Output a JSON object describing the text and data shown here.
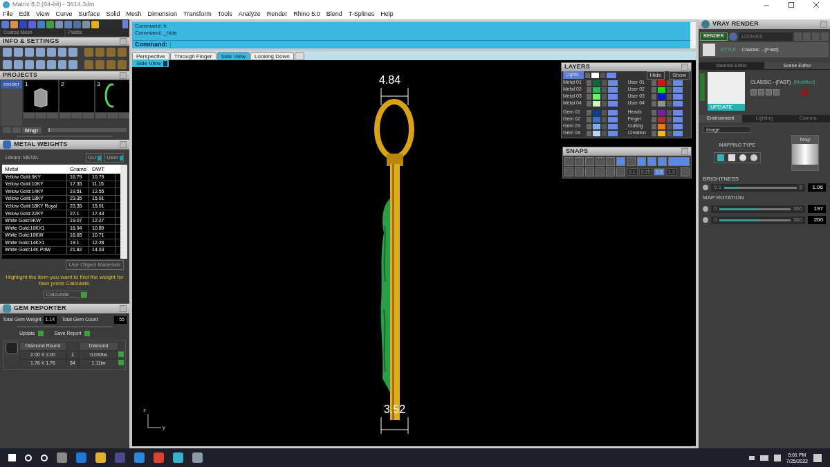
{
  "window": {
    "title": "Matrix 8.0 (64-bit) - 3614.3dm"
  },
  "menu": [
    "File",
    "Edit",
    "View",
    "Curve",
    "Surface",
    "Solid",
    "Mesh",
    "Dimension",
    "Transform",
    "Tools",
    "Analyze",
    "Render",
    "Rhino 5.0",
    "Blend",
    "T-Splines",
    "Help"
  ],
  "left_panel": {
    "mesh_dropdown": "Coarse Mesh",
    "material_dropdown": "Plastic",
    "info_title": "INFO & SETTINGS",
    "projects": {
      "title": "PROJECTS",
      "items": [
        {
          "label": "render",
          "selected": true
        }
      ],
      "slots": [
        "1",
        "2",
        "3"
      ],
      "manager_button": "Mngr",
      "thumbnail_slider": {
        "level": 0.02
      }
    },
    "metal_weights": {
      "title": "METAL WEIGHTS",
      "library": "Library: METAL",
      "toggles": [
        "GU",
        "User"
      ],
      "columns": [
        "Metal",
        "Grams",
        "DWT"
      ],
      "rows": [
        [
          "Yellow Gold:9KY",
          "16.79",
          "10.79"
        ],
        [
          "Yellow Gold:10KY",
          "17.35",
          "11.15"
        ],
        [
          "Yellow Gold:14KY",
          "19.51",
          "12.55"
        ],
        [
          "Yellow Gold:18KY",
          "23.35",
          "15.01"
        ],
        [
          "Yellow Gold:18KY Royal",
          "23.35",
          "15.01"
        ],
        [
          "Yellow Gold:22KY",
          "27.1",
          "17.43"
        ],
        [
          "White Gold:9KW",
          "19.07",
          "12.27"
        ],
        [
          "White Gold:10KX1",
          "16.94",
          "10.89"
        ],
        [
          "White Gold:10KW",
          "16.65",
          "10.71"
        ],
        [
          "White Gold:14KX1",
          "19.1",
          "12.28"
        ],
        [
          "White Gold:14K PdW",
          "21.82",
          "14.03"
        ]
      ],
      "use_object_materials": "Use Object Materials",
      "hint": "Highlight the item you want to find the weight for then press Calculate.",
      "calculate": "Calculate"
    },
    "gem_reporter": {
      "title": "GEM REPORTER",
      "total_weight_label": "Total Gem Weight",
      "total_weight": "1.14",
      "total_count_label": "Total Gem Count",
      "total_count": "55",
      "update": "Update",
      "save_report": "Save Report",
      "columns": [
        "Diamond Round",
        "",
        "Diamond"
      ],
      "rows": [
        [
          "2.00 X 2.00",
          "1",
          "0.030tw"
        ],
        [
          "1.76 X 1.76",
          "54",
          "1.11tw"
        ]
      ]
    }
  },
  "command": {
    "lines": [
      "Command: h",
      "Command: _hide"
    ],
    "prompt": "Command:"
  },
  "viewport_tabs": [
    {
      "label": "Perspective",
      "selected": false
    },
    {
      "label": "Through Finger",
      "selected": false
    },
    {
      "label": "Side View",
      "selected": true
    },
    {
      "label": "Looking Down",
      "selected": false
    }
  ],
  "viewport": {
    "view_menu": "Side View",
    "top_dimension": "4.84",
    "bottom_dimension": "3.52",
    "axis_labels": [
      "z",
      "y"
    ]
  },
  "layers": {
    "title": "LAYERS",
    "lights": "Lights",
    "hide": "Hide",
    "show": "Show",
    "left": [
      {
        "name": "Metal 01",
        "color": "#0b6b3e"
      },
      {
        "name": "Metal 02",
        "color": "#2fb460"
      },
      {
        "name": "Metal 03",
        "color": "#6ff06a"
      },
      {
        "name": "Metal 04",
        "color": "#c8f5c0"
      },
      {
        "name": "Gem 01",
        "color": "#0d3d99"
      },
      {
        "name": "Gem 02",
        "color": "#3a6fd0"
      },
      {
        "name": "Gem 03",
        "color": "#7fb0f0"
      },
      {
        "name": "Gem 04",
        "color": "#bcd6f7"
      }
    ],
    "right": [
      {
        "name": "User 01",
        "color": "#e01010"
      },
      {
        "name": "User 02",
        "color": "#10e010"
      },
      {
        "name": "User 03",
        "color": "#0818d8"
      },
      {
        "name": "User 04",
        "color": "#909090"
      },
      {
        "name": "Heads",
        "color": "#7a1fa8"
      },
      {
        "name": "Finger",
        "color": "#b03030"
      },
      {
        "name": "Cutting",
        "color": "#f07818"
      },
      {
        "name": "Creation",
        "color": "#f0b818"
      }
    ]
  },
  "snaps": {
    "title": "SNAPS",
    "increments": [
      {
        "label": "0.1",
        "selected": false
      },
      {
        "label": "0.25",
        "selected": false
      },
      {
        "label": "0.5",
        "selected": true
      },
      {
        "label": "1.0",
        "selected": false
      }
    ]
  },
  "vray": {
    "title": "VRAY RENDER",
    "render": "RENDER",
    "resolution": "1200x900",
    "style_label": "STYLE",
    "style": "Classic - (Fast)",
    "editor_tabs": [
      {
        "label": "Material Editor",
        "selected": false
      },
      {
        "label": "Scene Editor",
        "selected": true
      }
    ],
    "preset": "CLASSIC - (FAST)",
    "modified": "(Modified)",
    "update": "UPDATE",
    "env_tabs": [
      {
        "label": "Environment",
        "selected": true
      },
      {
        "label": "Lighting",
        "selected": false
      },
      {
        "label": "Camera",
        "selected": false
      }
    ],
    "env_type": "Image",
    "mapping_type": "MAPPING TYPE",
    "map": "Map",
    "brightness": {
      "label": "BRIGHTNESS",
      "min": "0.1",
      "max": "5",
      "value": "1.06",
      "level": 0.2
    },
    "map_rotation": {
      "label": "MAP ROTATION",
      "sliders": [
        {
          "min": "0",
          "max": "360",
          "value": "197",
          "level": 0.55
        },
        {
          "min": "0",
          "max": "360",
          "value": "200",
          "level": 0.56
        }
      ]
    }
  },
  "taskbar": {
    "time": "5:01 PM",
    "date": "7/25/2022"
  }
}
